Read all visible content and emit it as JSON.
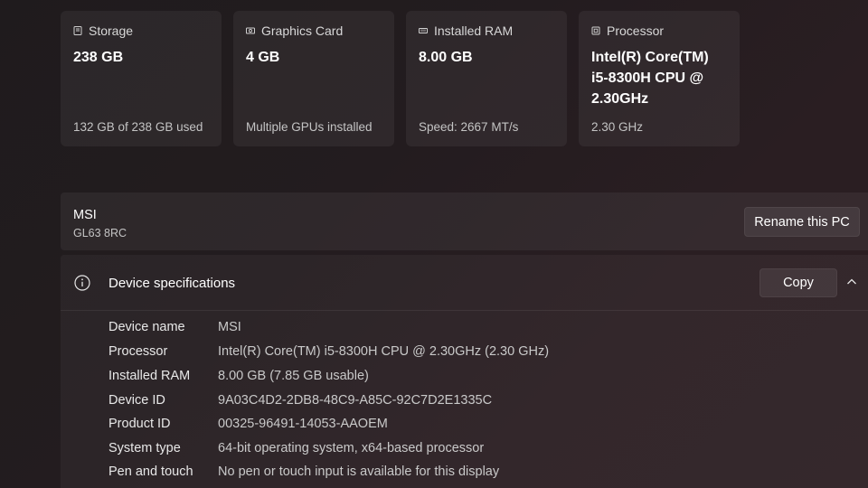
{
  "cards": [
    {
      "title": "Storage",
      "value": "238 GB",
      "sub": "132 GB of 238 GB used",
      "icon": "storage-icon"
    },
    {
      "title": "Graphics Card",
      "value": "4 GB",
      "sub": "Multiple GPUs installed",
      "icon": "graphics-card-icon"
    },
    {
      "title": "Installed RAM",
      "value": "8.00 GB",
      "sub": "Speed: 2667 MT/s",
      "icon": "ram-icon"
    },
    {
      "title": "Processor",
      "value": "Intel(R) Core(TM) i5-8300H CPU @ 2.30GHz",
      "sub": "2.30 GHz",
      "icon": "processor-icon"
    }
  ],
  "device": {
    "brand": "MSI",
    "model": "GL63 8RC",
    "rename_label": "Rename this PC"
  },
  "specs": {
    "title": "Device specifications",
    "copy_label": "Copy",
    "rows": [
      {
        "label": "Device name",
        "value": "MSI"
      },
      {
        "label": "Processor",
        "value": "Intel(R) Core(TM) i5-8300H CPU @ 2.30GHz (2.30 GHz)"
      },
      {
        "label": "Installed RAM",
        "value": "8.00 GB (7.85 GB usable)"
      },
      {
        "label": "Device ID",
        "value": "9A03C4D2-2DB8-48C9-A85C-92C7D2E1335C"
      },
      {
        "label": "Product ID",
        "value": "00325-96491-14053-AAOEM"
      },
      {
        "label": "System type",
        "value": "64-bit operating system, x64-based processor"
      },
      {
        "label": "Pen and touch",
        "value": "No pen or touch input is available for this display"
      }
    ]
  }
}
